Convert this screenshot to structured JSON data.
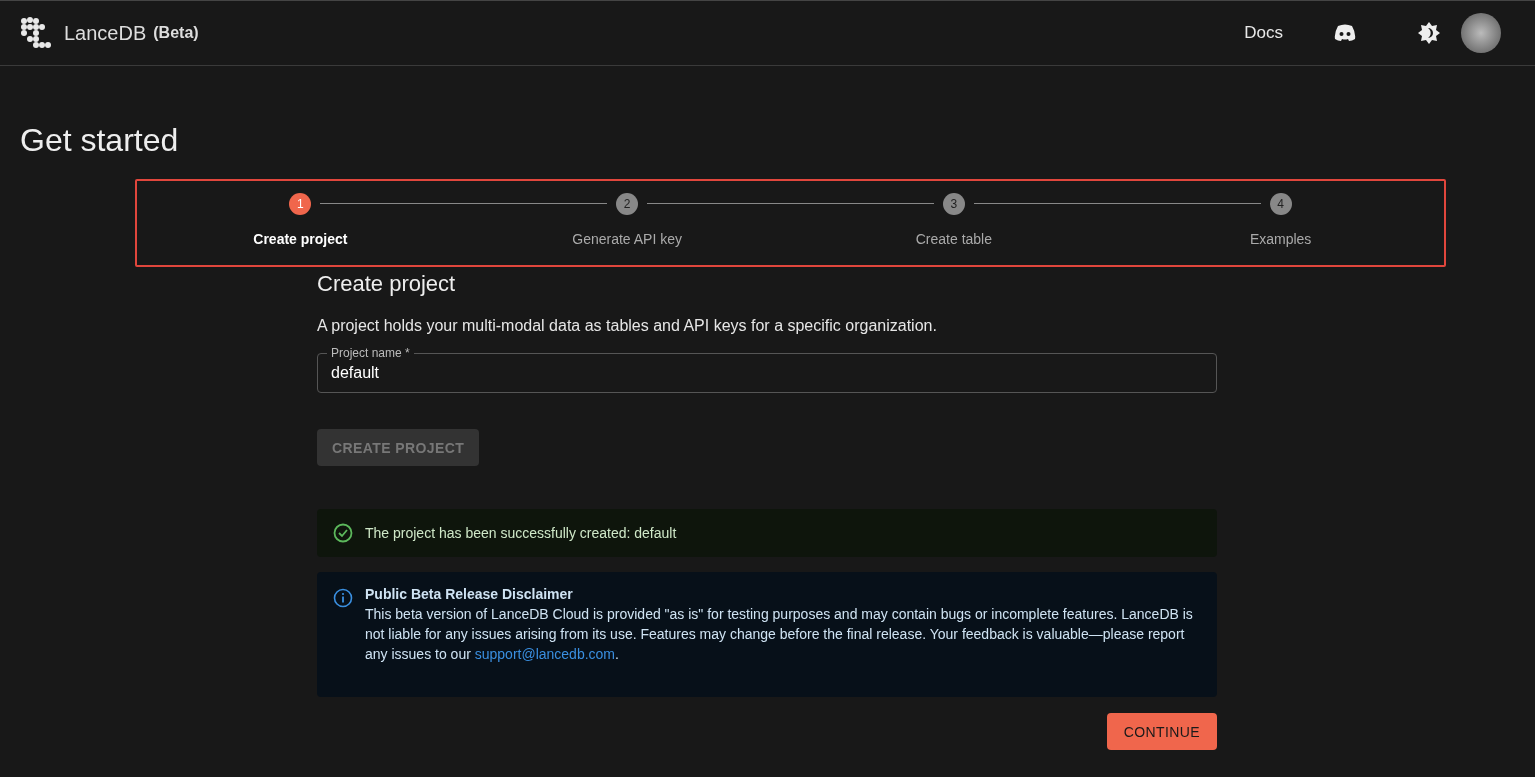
{
  "header": {
    "brand": "LanceDB",
    "badge": "(Beta)",
    "nav_link": "Docs"
  },
  "title": "Get started",
  "stepper": {
    "highlighted": true,
    "steps": [
      {
        "number": "1",
        "label": "Create project",
        "selected": true
      },
      {
        "number": "2",
        "label": "Generate API key",
        "selected": false
      },
      {
        "number": "3",
        "label": "Create table",
        "selected": false
      },
      {
        "number": "4",
        "label": "Examples",
        "selected": false
      }
    ]
  },
  "section": {
    "heading": "Create project",
    "description": "A project holds your multi-modal data as tables and API keys for a specific organization.",
    "field": {
      "label": "Project name",
      "required_mark": "*",
      "value": "default"
    },
    "create_button": {
      "label": "CREATE PROJECT",
      "disabled": true
    }
  },
  "success_alert": {
    "message": "The project has been successfully created: default"
  },
  "info_alert": {
    "title": "Public Beta Release Disclaimer",
    "text": "This beta version of LanceDB Cloud is provided \"as is\" for testing purposes and may contain bugs or incomplete features. LanceDB is not liable for any issues arising from its use. Features may change before the final release. Your feedback is valuable—please report any issues to our ",
    "link": "support@lancedb.com",
    "text_after": "."
  },
  "continue_button": {
    "label": "CONTINUE"
  }
}
